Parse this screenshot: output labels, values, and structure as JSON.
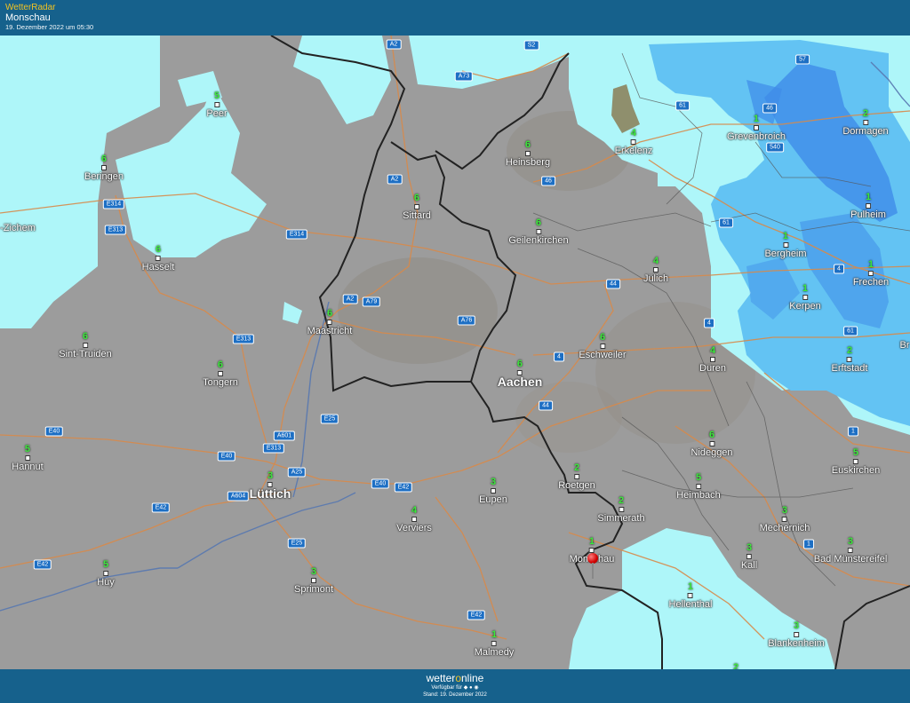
{
  "header": {
    "brand": "WetterRadar",
    "location": "Monschau",
    "datetime": "19. Dezember 2022 um 05:30"
  },
  "footer": {
    "logo_pre": "wetter",
    "logo_o": "o",
    "logo_post": "nline",
    "available": "Verfügbar für",
    "store_icons": "◆ ● ◉",
    "stand": "Stand: 19. Dezember 2022"
  },
  "colors": {
    "ground_dry": "#9c9c9c",
    "light_precip": "#aef6f9",
    "moderate_precip": "#63c3f3",
    "heavy_precip": "#3f8ce8",
    "roads": "#d88a4a",
    "borders": "#222222",
    "header_bg": "#16618c"
  },
  "cities": [
    {
      "name": "Peer",
      "temp": "5"
    },
    {
      "name": "Beringen",
      "temp": "6"
    },
    {
      "name": "-Zichem",
      "temp": ""
    },
    {
      "name": "Hasselt",
      "temp": "6"
    },
    {
      "name": "Sint-Truiden",
      "temp": "6"
    },
    {
      "name": "Tongern",
      "temp": "6"
    },
    {
      "name": "Hannut",
      "temp": "5"
    },
    {
      "name": "Lüttich",
      "temp": "3"
    },
    {
      "name": "Huy",
      "temp": "5"
    },
    {
      "name": "Sprimont",
      "temp": "3"
    },
    {
      "name": "Verviers",
      "temp": "4"
    },
    {
      "name": "Eupen",
      "temp": "3"
    },
    {
      "name": "Malmedy",
      "temp": "1"
    },
    {
      "name": "Maastricht",
      "temp": "6"
    },
    {
      "name": "Sittard",
      "temp": "6"
    },
    {
      "name": "Heinsberg",
      "temp": "6"
    },
    {
      "name": "Geilenkirchen",
      "temp": "6"
    },
    {
      "name": "Aachen",
      "temp": "6"
    },
    {
      "name": "Eschweiler",
      "temp": "6"
    },
    {
      "name": "Jülich",
      "temp": "4"
    },
    {
      "name": "Erkelenz",
      "temp": "4"
    },
    {
      "name": "Düren",
      "temp": "4"
    },
    {
      "name": "Roetgen",
      "temp": "2"
    },
    {
      "name": "Simmerath",
      "temp": "2"
    },
    {
      "name": "Monschau",
      "temp": "1"
    },
    {
      "name": "Nideggen",
      "temp": "6"
    },
    {
      "name": "Heimbach",
      "temp": "5"
    },
    {
      "name": "Hellenthal",
      "temp": "1"
    },
    {
      "name": "Kall",
      "temp": "3"
    },
    {
      "name": "Mechernich",
      "temp": "3"
    },
    {
      "name": "Bad Münstereifel",
      "temp": "3"
    },
    {
      "name": "Euskirchen",
      "temp": "5"
    },
    {
      "name": "Blankenheim",
      "temp": "3"
    },
    {
      "name": "Erftstadt",
      "temp": "2"
    },
    {
      "name": "Kerpen",
      "temp": "1"
    },
    {
      "name": "Frechen",
      "temp": "1"
    },
    {
      "name": "Bergheim",
      "temp": "1"
    },
    {
      "name": "Pulheim",
      "temp": "1"
    },
    {
      "name": "Grevenbroich",
      "temp": "1"
    },
    {
      "name": "Dormagen",
      "temp": "2"
    },
    {
      "name": "Br",
      "temp": ""
    },
    {
      "name": "",
      "temp": "2"
    }
  ],
  "road_signs": [
    "A2",
    "A73",
    "S2",
    "57",
    "61",
    "46",
    "540",
    "46",
    "61",
    "A2",
    "E314",
    "E313",
    "E314",
    "A2",
    "A79",
    "A76",
    "44",
    "4",
    "4",
    "44",
    "4",
    "61",
    "1",
    "E313",
    "E25",
    "A601",
    "E313",
    "E40",
    "A25",
    "A604",
    "E40",
    "E42",
    "E40",
    "E42",
    "E25",
    "E42",
    "E42",
    "1"
  ]
}
